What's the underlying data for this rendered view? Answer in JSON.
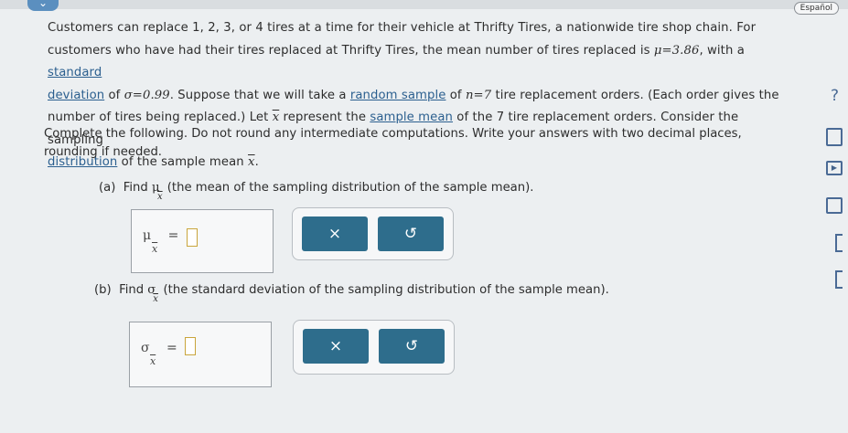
{
  "header": {
    "language_label": "Español"
  },
  "problem": {
    "p1": "Customers can replace 1, 2, 3, or 4 tires at a time for their vehicle at Thrifty Tires, a nationwide tire shop chain. For",
    "p2a": "customers who have had their tires replaced at Thrifty Tires, the mean number of tires replaced is ",
    "mu_value": "μ=3.86",
    "p2b": ", with a ",
    "link_standard": "standard",
    "link_deviation": "deviation",
    "p3a": " of ",
    "sigma_value": "σ=0.99",
    "p3b": ". Suppose that we will take a ",
    "link_random_sample": "random sample",
    "p3c": " of ",
    "n_value": "n=7",
    "p3d": " tire replacement orders. (Each order gives the",
    "p4a": "number of tires being replaced.) Let ",
    "xbar": "x",
    "p4b": " represent the ",
    "link_sample_mean": "sample mean",
    "p4c": " of the 7 tire replacement orders. Consider the sampling",
    "link_distribution": "distribution",
    "p5a": " of the sample mean ",
    "p5b": "."
  },
  "instructions": "Complete the following. Do not round any intermediate computations. Write your answers with two decimal places, rounding if needed.",
  "part_a": {
    "label": "(a)",
    "find": "Find",
    "symbol": "μ",
    "sub": "x",
    "description": "(the mean of the sampling distribution of the sample mean).",
    "answer_symbol": "μ",
    "answer_sub": "x",
    "equals": "="
  },
  "part_b": {
    "label": "(b)",
    "find": "Find",
    "symbol": "σ",
    "sub": "x",
    "description": "(the standard deviation of the sampling distribution of the sample mean).",
    "answer_symbol": "σ",
    "answer_sub": "x",
    "equals": "="
  },
  "buttons": {
    "clear": "×",
    "undo": "↺"
  },
  "sidebar": {
    "help": "?"
  },
  "colors": {
    "button": "#2e6d8c",
    "link": "#2b5f8f",
    "background": "#eceff1"
  }
}
